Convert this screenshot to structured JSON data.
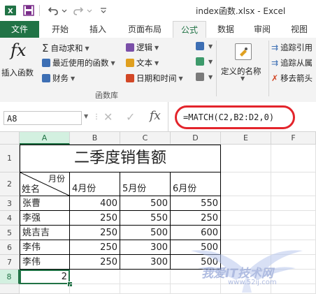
{
  "window": {
    "title": "index函数.xlsx - Excel"
  },
  "tabs": [
    "文件",
    "开始",
    "插入",
    "页面布局",
    "公式",
    "数据",
    "审阅",
    "视图"
  ],
  "ribbon": {
    "insert_function": "插入函数",
    "autosum": "自动求和",
    "recent": "最近使用的函数",
    "financial": "财务",
    "logical": "逻辑",
    "text": "文本",
    "datetime": "日期和时间",
    "defined_names": "定义的名称",
    "trace_precedents": "追踪引用",
    "trace_dependents": "追踪从属",
    "remove_arrows": "移去箭头",
    "group_label": "函数库",
    "fx_label": "fx"
  },
  "formula_bar": {
    "name_box": "A8",
    "formula": "=MATCH(C2,B2:D2,0)",
    "cancel": "✕",
    "enter": "✓",
    "fx": "fx"
  },
  "grid": {
    "columns": [
      "A",
      "B",
      "C",
      "D",
      "E",
      "F"
    ],
    "rows": [
      "1",
      "2",
      "3",
      "4",
      "5",
      "6",
      "7",
      "8"
    ],
    "sheet_title": "二季度销售额",
    "header_diag_top": "月份",
    "header_diag_bottom": "姓名",
    "month_headers": [
      "4月份",
      "5月份",
      "6月份"
    ],
    "data": [
      {
        "name": "张曹",
        "values": [
          "400",
          "500",
          "550"
        ]
      },
      {
        "name": "李强",
        "values": [
          "250",
          "550",
          "250"
        ]
      },
      {
        "name": "姚吉吉",
        "values": [
          "250",
          "500",
          "600"
        ]
      },
      {
        "name": "李伟",
        "values": [
          "250",
          "300",
          "500"
        ]
      },
      {
        "name": "李伟",
        "values": [
          "250",
          "300",
          "500"
        ]
      }
    ],
    "result": "2"
  },
  "watermark": {
    "text": "我爱IT技术网",
    "url": "www.52ij.com"
  },
  "colors": {
    "accent": "#217346",
    "highlight": "#e3242b"
  }
}
